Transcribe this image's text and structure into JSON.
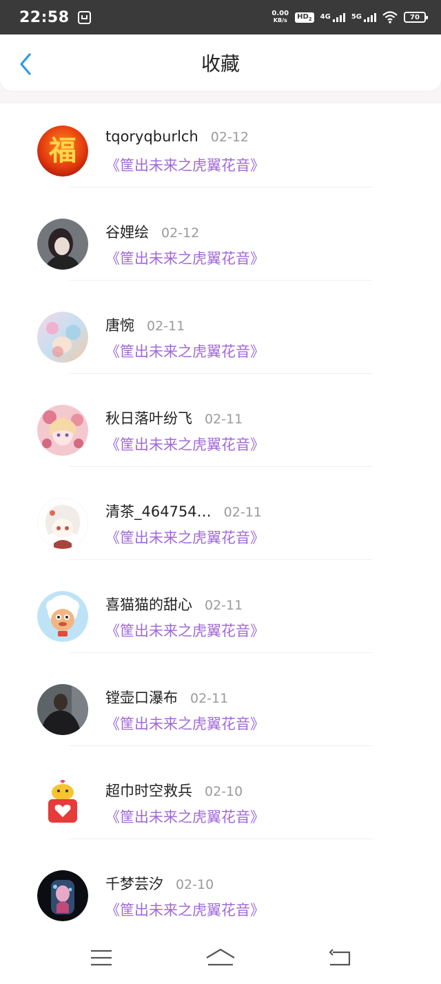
{
  "status_bar": {
    "time": "22:58",
    "net_speed_value": "0.00",
    "net_speed_unit": "KB/s",
    "hd_label": "HD",
    "hd_sub": "2",
    "signal1_label": "4G",
    "signal2_label": "5G",
    "battery_level": "70"
  },
  "header": {
    "title": "收藏",
    "back_icon": "chevron-left-icon"
  },
  "favorites": [
    {
      "name": "tqoryqburlch",
      "date": "02-12",
      "work": "《筐出未来之虎翼花音》"
    },
    {
      "name": "谷娌绘",
      "date": "02-12",
      "work": "《筐出未来之虎翼花音》"
    },
    {
      "name": "唐惋",
      "date": "02-11",
      "work": "《筐出未来之虎翼花音》"
    },
    {
      "name": "秋日落叶纷飞",
      "date": "02-11",
      "work": "《筐出未来之虎翼花音》"
    },
    {
      "name": "清茶_464754…",
      "date": "02-11",
      "work": "《筐出未来之虎翼花音》"
    },
    {
      "name": "喜猫猫的甜心",
      "date": "02-11",
      "work": "《筐出未来之虎翼花音》"
    },
    {
      "name": "镗壶口瀑布",
      "date": "02-11",
      "work": "《筐出未来之虎翼花音》"
    },
    {
      "name": "超巾时空救兵",
      "date": "02-10",
      "work": "《筐出未来之虎翼花音》"
    },
    {
      "name": "千梦芸汐",
      "date": "02-10",
      "work": "《筐出未来之虎翼花音》"
    }
  ],
  "avatar_fu_char": "福",
  "colors": {
    "accent_back": "#2a9ae8",
    "work_title": "#a06ad8",
    "status_bar_bg": "#3a3a3a"
  },
  "bottom_nav": {
    "menu_icon": "menu-icon",
    "home_icon": "home-icon",
    "back_icon": "return-icon"
  }
}
